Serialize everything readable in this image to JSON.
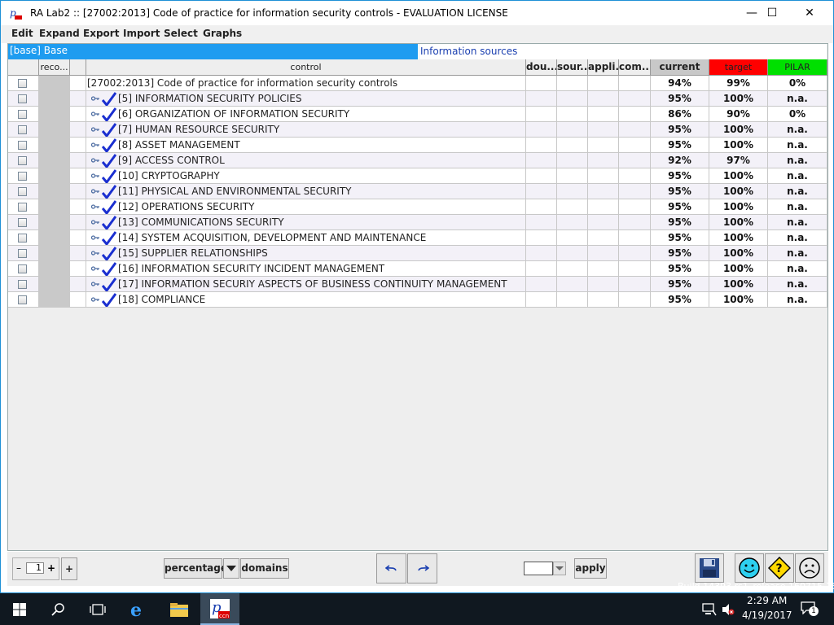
{
  "window": {
    "title": "RA Lab2 :: [27002:2013] Code of practice for information security controls - EVALUATION LICENSE",
    "minimize_label": "—",
    "maximize_label": "☐",
    "close_label": "✕"
  },
  "menu": {
    "items": [
      "Edit",
      "Expand",
      "Export",
      "Import",
      "Select",
      "Graphs"
    ]
  },
  "selection": {
    "base_label": "[base] Base",
    "info_sources_label": "Information sources"
  },
  "table": {
    "headers": {
      "checkbox": "",
      "reco": "reco...",
      "blank": "",
      "control": "control",
      "dou": "dou...",
      "sour": "sour...",
      "appli": "appli...",
      "com": "com...",
      "current": "current",
      "target": "target",
      "pilar": "PILAR"
    },
    "header_colors": {
      "current_bg": "#c8c8c8",
      "target_bg": "#ff0000",
      "pilar_bg": "#00e000"
    },
    "rows": [
      {
        "control": "[27002:2013] Code of practice for information security controls",
        "current": "94%",
        "target": "99%",
        "pilar": "0%",
        "root": true
      },
      {
        "control": "[5] INFORMATION SECURITY POLICIES",
        "current": "95%",
        "target": "100%",
        "pilar": "n.a."
      },
      {
        "control": "[6] ORGANIZATION OF INFORMATION SECURITY",
        "current": "86%",
        "target": "90%",
        "pilar": "0%"
      },
      {
        "control": "[7] HUMAN RESOURCE SECURITY",
        "current": "95%",
        "target": "100%",
        "pilar": "n.a."
      },
      {
        "control": "[8] ASSET MANAGEMENT",
        "current": "95%",
        "target": "100%",
        "pilar": "n.a."
      },
      {
        "control": "[9] ACCESS CONTROL",
        "current": "92%",
        "target": "97%",
        "pilar": "n.a."
      },
      {
        "control": "[10] CRYPTOGRAPHY",
        "current": "95%",
        "target": "100%",
        "pilar": "n.a."
      },
      {
        "control": "[11] PHYSICAL AND ENVIRONMENTAL SECURITY",
        "current": "95%",
        "target": "100%",
        "pilar": "n.a."
      },
      {
        "control": "[12] OPERATIONS SECURITY",
        "current": "95%",
        "target": "100%",
        "pilar": "n.a."
      },
      {
        "control": "[13] COMMUNICATIONS SECURITY",
        "current": "95%",
        "target": "100%",
        "pilar": "n.a."
      },
      {
        "control": "[14] SYSTEM ACQUISITION, DEVELOPMENT AND MAINTENANCE",
        "current": "95%",
        "target": "100%",
        "pilar": "n.a."
      },
      {
        "control": "[15] SUPPLIER RELATIONSHIPS",
        "current": "95%",
        "target": "100%",
        "pilar": "n.a."
      },
      {
        "control": "[16] INFORMATION SECURITY INCIDENT MANAGEMENT",
        "current": "95%",
        "target": "100%",
        "pilar": "n.a."
      },
      {
        "control": "[17] INFORMATION SECURIY ASPECTS OF BUSINESS CONTINUITY MANAGEMENT",
        "current": "95%",
        "target": "100%",
        "pilar": "n.a."
      },
      {
        "control": "[18] COMPLIANCE",
        "current": "95%",
        "target": "100%",
        "pilar": "n.a."
      }
    ]
  },
  "bottom": {
    "minus_label": "–",
    "level_value": "1",
    "plus_label": "+",
    "plus2_label": "+",
    "mode_value": "percentage",
    "domains_label": "domains",
    "apply_label": "apply",
    "icons": [
      "undo-icon",
      "redo-icon",
      "save-icon",
      "smiley-icon",
      "question-icon",
      "sad-face-icon"
    ]
  },
  "build_text": "Build 14393.rs1_release.160715-1616",
  "taskbar": {
    "time": "2:29 AM",
    "date": "4/19/2017",
    "notification_count": "1",
    "icons": [
      "start-icon",
      "search-icon",
      "task-view-icon",
      "edge-icon",
      "file-explorer-icon",
      "ra-lab-icon"
    ]
  },
  "colors": {
    "selection_blue": "#1e9cf0",
    "row_alt": "#f3f1f8",
    "check_blue": "#1a2fd0",
    "taskbar": "#101820"
  }
}
